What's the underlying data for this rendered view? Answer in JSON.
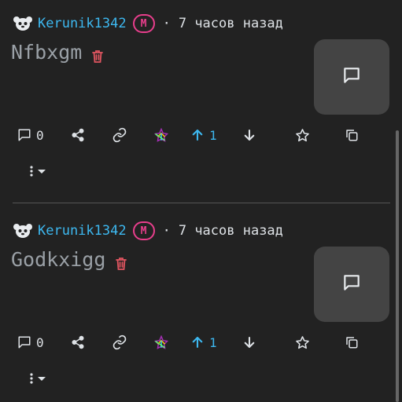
{
  "posts": [
    {
      "author": "Kerunik1342",
      "badge": "M",
      "separator": "·",
      "time": "7 часов назад",
      "title": "Nfbxgm",
      "comments": "0",
      "score": "1"
    },
    {
      "author": "Kerunik1342",
      "badge": "M",
      "separator": "·",
      "time": "7 часов назад",
      "title": "Godkxigg",
      "comments": "0",
      "score": "1"
    }
  ],
  "colors": {
    "background": "#222222",
    "author": "#3db8f0",
    "mod_badge": "#e83e8c",
    "trash": "#e05560",
    "thumbnail": "#444444"
  }
}
